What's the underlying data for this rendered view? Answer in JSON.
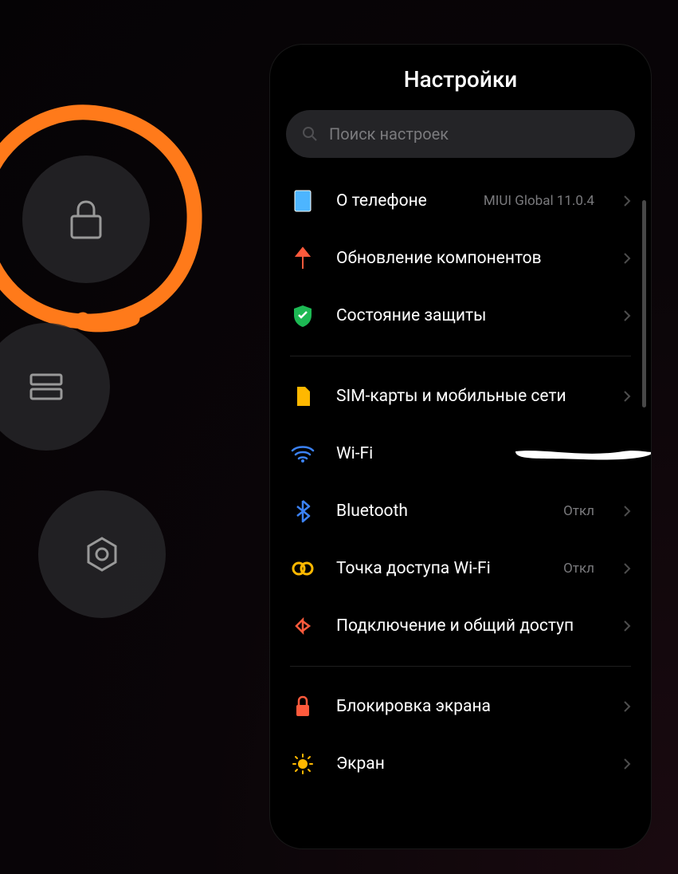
{
  "settings": {
    "title": "Настройки",
    "search": {
      "placeholder": "Поиск настроек"
    },
    "groups": [
      [
        {
          "label": "О телефоне",
          "value": "MIUI Global 11.0.4",
          "icon": "phone-info"
        },
        {
          "label": "Обновление компонентов",
          "icon": "update-arrow"
        },
        {
          "label": "Состояние защиты",
          "icon": "shield-check"
        }
      ],
      [
        {
          "label": "SIM-карты и мобильные сети",
          "icon": "sim"
        },
        {
          "label": "Wi-Fi",
          "icon": "wifi",
          "redacted": true
        },
        {
          "label": "Bluetooth",
          "value": "Откл",
          "icon": "bluetooth"
        },
        {
          "label": "Точка доступа Wi-Fi",
          "value": "Откл",
          "icon": "hotspot"
        },
        {
          "label": "Подключение и общий доступ",
          "icon": "share"
        }
      ],
      [
        {
          "label": "Блокировка экрана",
          "icon": "lock"
        },
        {
          "label": "Экран",
          "icon": "brightness"
        }
      ]
    ]
  },
  "sideButtons": {
    "lock": {
      "highlighted": true
    },
    "recents": {},
    "settings": {}
  }
}
